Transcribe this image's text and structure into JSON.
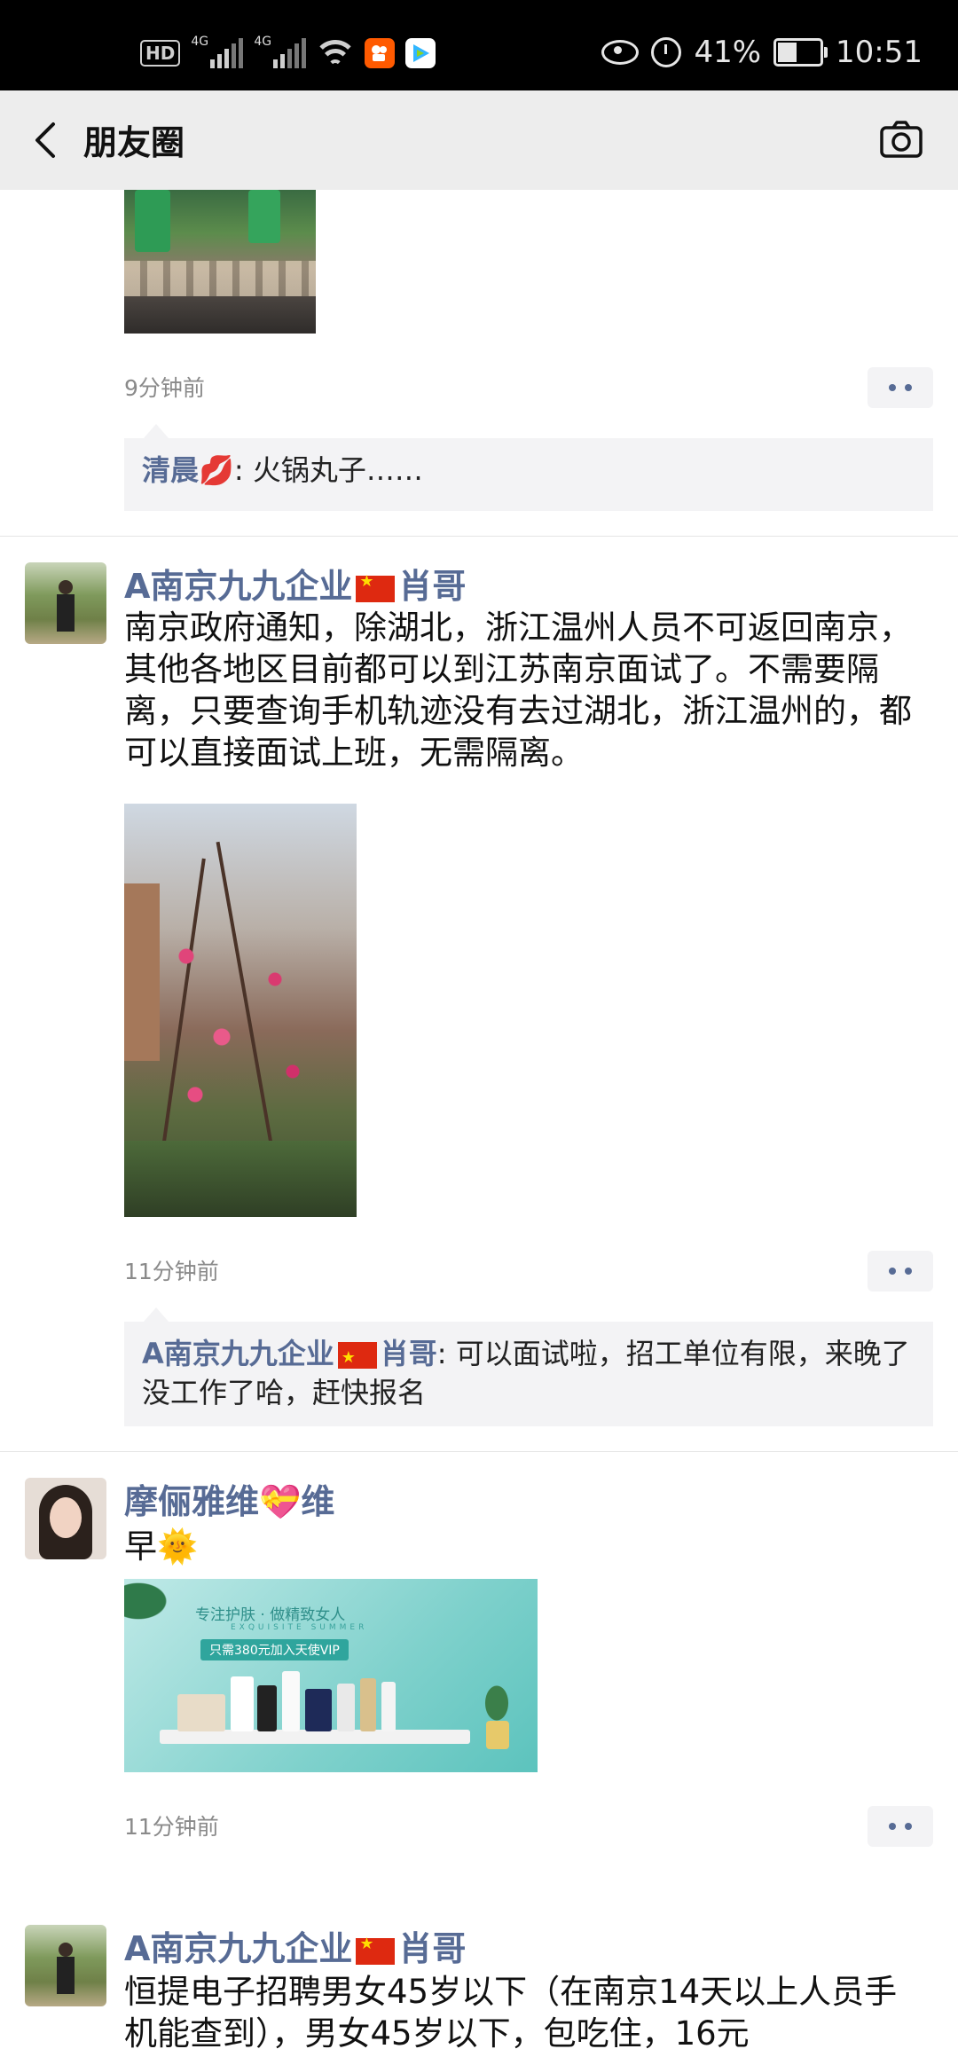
{
  "status_bar": {
    "hd_label": "HD",
    "network_1": "4G",
    "network_2": "4G",
    "battery_percent": "41%",
    "battery_level": 0.41,
    "time": "10:51"
  },
  "nav": {
    "title": "朋友圈"
  },
  "posts": [
    {
      "time": "9分钟前",
      "comment": {
        "author": "清晨💋",
        "text": ": 火锅丸子……"
      }
    },
    {
      "author_before": "A南京九九企业",
      "author_after": "肖哥",
      "text": "南京政府通知，除湖北，浙江温州人员不可返回南京，其他各地区目前都可以到江苏南京面试了。不需要隔离，只要查询手机轨迹没有去过湖北，浙江温州的，都可以直接面试上班，无需隔离。",
      "time": "11分钟前",
      "comment": {
        "author_before": "A南京九九企业",
        "author_after": "肖哥",
        "text": ": 可以面试啦，招工单位有限，来晚了没工作了哈，赶快报名"
      }
    },
    {
      "author": "摩俪雅维💝维",
      "text": "早🌞",
      "ad": {
        "headline": "专注护肤 · 做精致女人",
        "subline": "EXQUISITE SUMMER",
        "badge": "只需380元加入天使VIP"
      },
      "time": "11分钟前"
    },
    {
      "author_before": "A南京九九企业",
      "author_after": "肖哥",
      "text": "恒提电子招聘男女45岁以下（在南京14天以上人员手机能查到），男女45岁以下，包吃住，16元"
    }
  ],
  "colors": {
    "name_blue": "#576b95",
    "status_bar_bg": "#000000",
    "nav_bg": "#ededed",
    "comment_bg": "#f3f3f5"
  }
}
